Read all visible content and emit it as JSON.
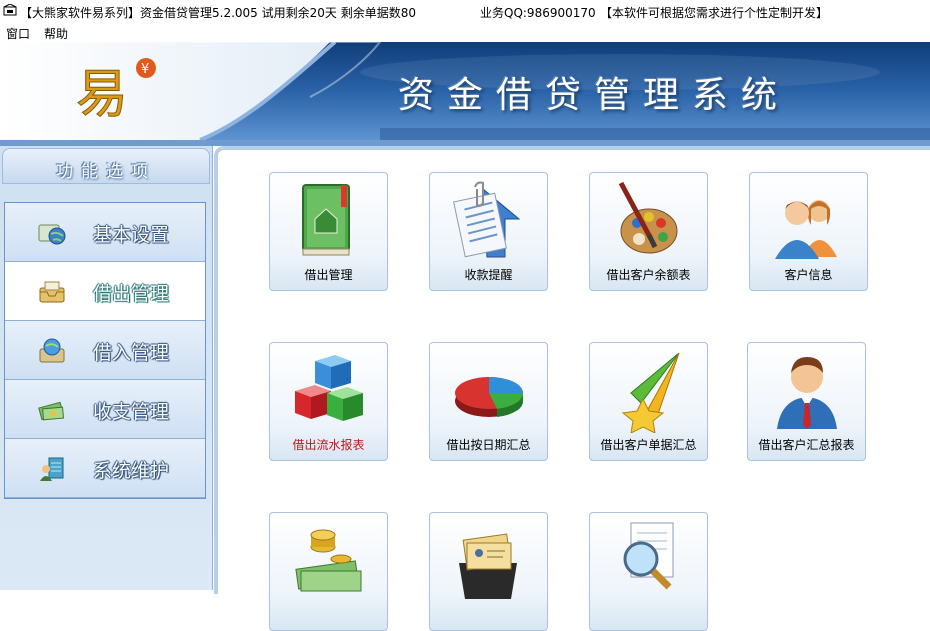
{
  "window": {
    "title": "【大熊家软件易系列】资金借贷管理5.2.005  试用剩余20天  剩余单据数80",
    "qq": "业务QQ:986900170",
    "note": "【本软件可根据您需求进行个性定制开发】"
  },
  "menu": {
    "window_label": "窗口",
    "help_label": "帮助"
  },
  "banner": {
    "title": "资金借贷管理系统",
    "logo_char": "易",
    "logo_badge": "¥"
  },
  "sidebar": {
    "header": "功能选项",
    "items": [
      {
        "label": "基本设置",
        "icon": "globe-icon"
      },
      {
        "label": "借出管理",
        "icon": "tray-icon",
        "active": true
      },
      {
        "label": "借入管理",
        "icon": "globe-tray-icon"
      },
      {
        "label": "收支管理",
        "icon": "cash-icon"
      },
      {
        "label": "系统维护",
        "icon": "users-network-icon"
      }
    ]
  },
  "tiles": [
    {
      "label": "借出管理",
      "icon": "green-book-icon"
    },
    {
      "label": "收款提醒",
      "icon": "document-clip-icon"
    },
    {
      "label": "借出客户余额表",
      "icon": "palette-icon"
    },
    {
      "label": "客户信息",
      "icon": "people-icon"
    },
    {
      "label": "借出流水报表",
      "icon": "cubes-icon",
      "highlight": "#c0151b"
    },
    {
      "label": "借出按日期汇总",
      "icon": "pie-chart-icon"
    },
    {
      "label": "借出客户单据汇总",
      "icon": "star-rocket-icon"
    },
    {
      "label": "借出客户汇总报表",
      "icon": "businessman-icon"
    },
    {
      "label": "",
      "icon": "money-stack-icon"
    },
    {
      "label": "",
      "icon": "card-file-icon"
    },
    {
      "label": "",
      "icon": "magnifier-document-icon"
    }
  ],
  "colors": {
    "banner_blue": "#1d4f8c",
    "accent_red": "#c0151b",
    "sidebar_border": "#6b94c7"
  }
}
